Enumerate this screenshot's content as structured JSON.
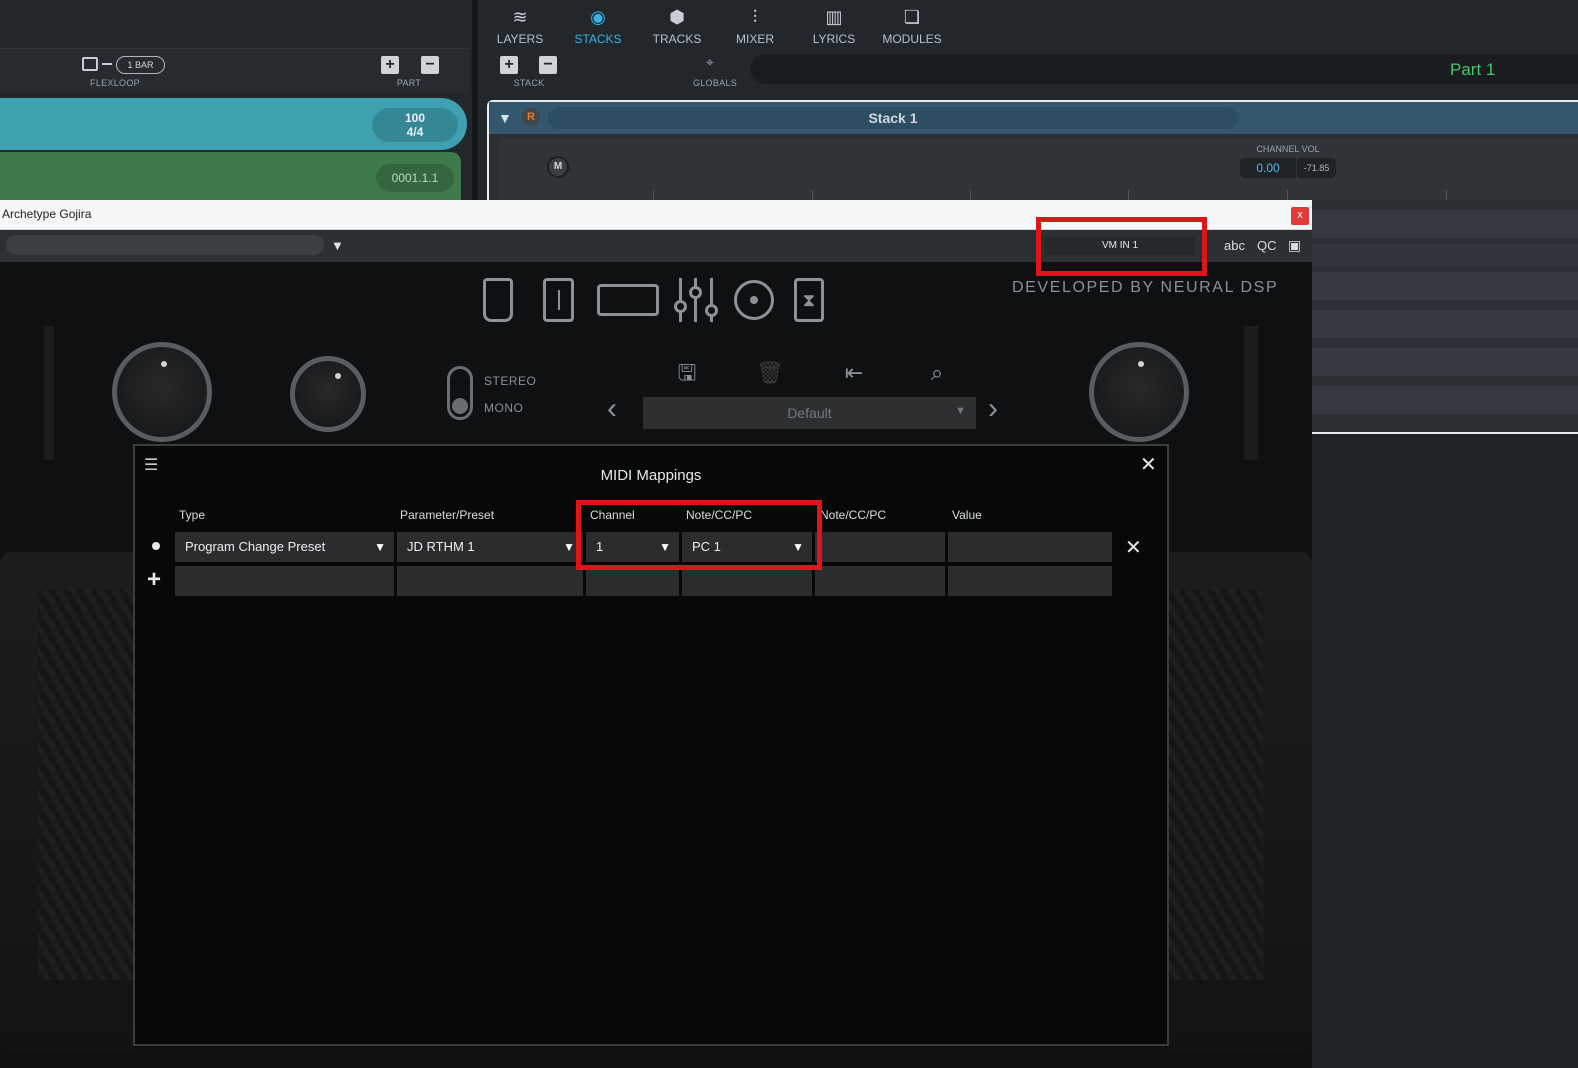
{
  "host": {
    "tabs": [
      {
        "label": "LAYERS",
        "icon": "layers-icon"
      },
      {
        "label": "STACKS",
        "icon": "stacks-icon",
        "active": true
      },
      {
        "label": "TRACKS",
        "icon": "tracks-icon"
      },
      {
        "label": "MIXER",
        "icon": "mixer-icon"
      },
      {
        "label": "LYRICS",
        "icon": "lyrics-icon"
      },
      {
        "label": "MODULES",
        "icon": "modules-icon"
      }
    ],
    "left_toolbar": {
      "bar_length": "1 BAR",
      "flexloop_label": "FLEXLOOP",
      "part_label": "PART"
    },
    "tempo": "100",
    "time_signature": "4/4",
    "position": "0001.1.1",
    "right_toolbar": {
      "stack_label": "STACK",
      "globals_label": "GLOBALS"
    },
    "part_display": "Part  1",
    "stack": {
      "name": "Stack 1",
      "record_badge": "R",
      "mute_button": "M",
      "channel_vol_label": "CHANNEL VOL",
      "channel_vol_value": "0.00",
      "channel_vol_db": "-71.85"
    },
    "accent_color": "#36b4e6"
  },
  "plugin": {
    "window_title": "Archetype Gojira",
    "close_label": "x",
    "midi_input": "VM IN 1",
    "toolbar": {
      "abc": "abc",
      "qc": "QC"
    },
    "developed_by": "DEVELOPED BY NEURAL DSP",
    "stereo_label": "STEREO",
    "mono_label": "MONO",
    "preset_name": "Default"
  },
  "midi_mappings": {
    "title": "MIDI Mappings",
    "columns": [
      "Type",
      "Parameter/Preset",
      "Channel",
      "Note/CC/PC",
      "Note/CC/PC",
      "Value"
    ],
    "rows": [
      {
        "type": "Program Change Preset",
        "parameter": "JD RTHM 1",
        "channel": "1",
        "note_cc_pc": "PC 1",
        "note_cc_pc_2": "",
        "value": ""
      }
    ],
    "highlight_color": "#e0151b"
  }
}
